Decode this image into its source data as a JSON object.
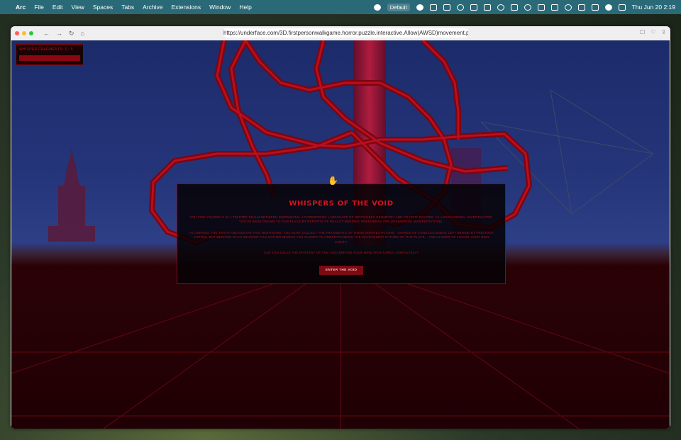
{
  "menubar": {
    "app": "Arc",
    "items": [
      "File",
      "Edit",
      "View",
      "Spaces",
      "Tabs",
      "Archive",
      "Extensions",
      "Window",
      "Help"
    ],
    "profile": "Default",
    "datetime": "Thu Jun 20  2:19"
  },
  "browser": {
    "url": "https://underface.com/3D.firstpersonwalkgame.horror.puzzle.interactive.Allow(AWSD)movement.putsou"
  },
  "game": {
    "hud_label": "WHISPER FRAGMENTS: 0 / 5",
    "dialog": {
      "title": "WHISPERS OF THE VOID",
      "paragraph1": "YOU FIND YOURSELF IN A TWISTED REALM BETWEEN DIMENSIONS. A FOREBODING LANDSCAPE OF IMPOSSIBLE GEOMETRY AND CRYPTIC ECHOES. AS A PARANORMAL INVESTIGATOR, YOU'VE BEEN DRAWN TO THIS PLACE BY REPORTS OF REALITY-BENDING PHENOMENA AND WHISPERING MANIFESTATIONS.",
      "paragraph2": "TO UNRAVEL THE TRUTH AND ESCAPE THIS NIGHTMARE, YOU MUST COLLECT THE FRAGMENTS OF THESE MANIFESTATIONS - SHARDS OF CONSCIOUSNESS LEFT BEHIND BY PREVIOUS VICTIMS. BUT BEWARE: EACH WHISPER YOU GATHER BRINGS YOU CLOSER TO UNDERSTANDING THE MALEVOLENT NATURE OF THIS PLACE... AND CLOSER TO LOSING YOUR OWN SANITY.",
      "paragraph3": "CAN YOU SOLVE THE MYSTERY OF THE VOID BEFORE YOUR MIND FRACTURES COMPLETELY?",
      "button": "ENTER THE VOID"
    }
  },
  "colors": {
    "menubar": "#2a6a78",
    "accent_red": "#c0121c",
    "dialog_border": "#8a0a14",
    "sky": "#25357a"
  }
}
